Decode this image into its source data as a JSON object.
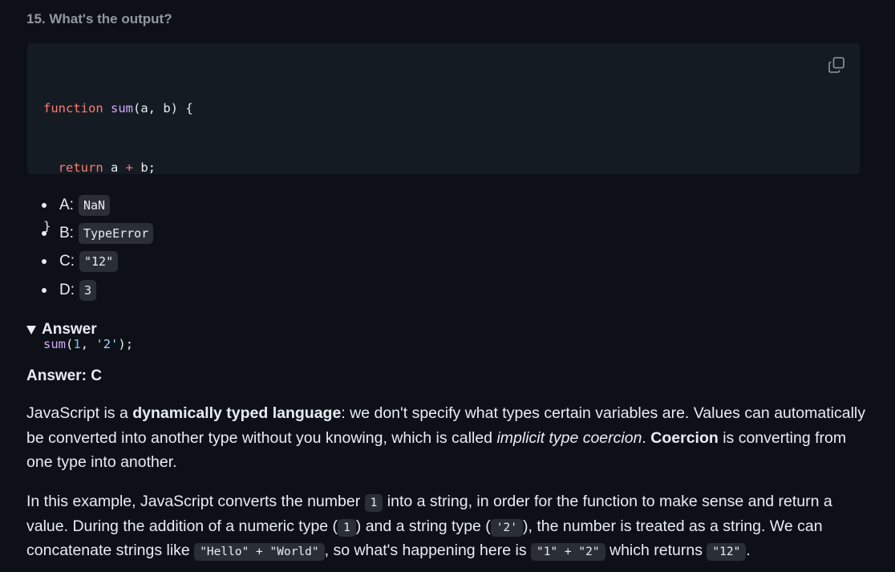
{
  "question": {
    "title": "15. What's the output?"
  },
  "code": {
    "line1": {
      "kw": "function",
      "fn": "sum",
      "rest": "(a, b) {"
    },
    "line2": {
      "indent": "  ",
      "kw": "return",
      "a": " a ",
      "op": "+",
      "b": " b;"
    },
    "line3": "}",
    "line5": {
      "fn": "sum",
      "open": "(",
      "num": "1",
      "sep": ", ",
      "str": "'2'",
      "close": ");"
    },
    "copy_icon": "copy-icon"
  },
  "options": [
    {
      "letter": "A:",
      "value": "NaN"
    },
    {
      "letter": "B:",
      "value": "TypeError"
    },
    {
      "letter": "C:",
      "value": "\"12\""
    },
    {
      "letter": "D:",
      "value": "3"
    }
  ],
  "answer": {
    "summary_label": "Answer",
    "heading": "Answer: C",
    "p1": {
      "t1": "JavaScript is a ",
      "b1": "dynamically typed language",
      "t2": ": we don't specify what types certain variables are. Values can automatically be converted into another type without you knowing, which is called ",
      "i1": "implicit type coercion",
      "t3": ". ",
      "b2": "Coercion",
      "t4": " is converting from one type into another."
    },
    "p2": {
      "t1": "In this example, JavaScript converts the number ",
      "c1": "1",
      "t2": " into a string, in order for the function to make sense and return a value. During the addition of a numeric type (",
      "c2": "1",
      "t3": ") and a string type (",
      "c3": "'2'",
      "t4": "), the number is treated as a string. We can concatenate strings like ",
      "c4": "\"Hello\" + \"World\"",
      "t5": ", so what's happening here is ",
      "c5": "\"1\" + \"2\"",
      "t6": " which returns ",
      "c6": "\"12\"",
      "t7": "."
    }
  },
  "colors": {
    "background": "#0d1117",
    "code_background": "#151b23",
    "keyword": "#ff7b72",
    "function": "#d2a8ff",
    "number": "#79c0ff",
    "string": "#a5d6ff"
  }
}
